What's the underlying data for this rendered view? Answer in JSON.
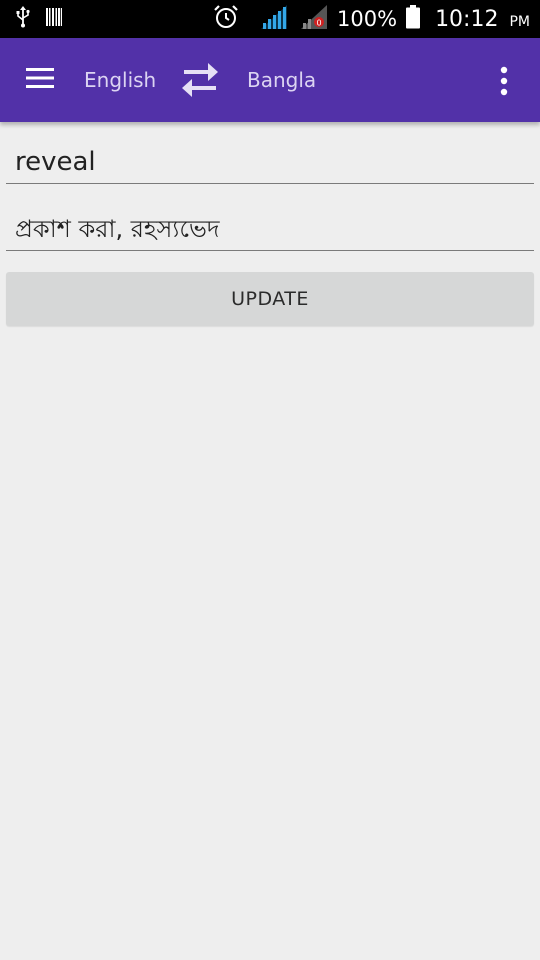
{
  "status_bar": {
    "battery_percent": "100%",
    "time": "10:12",
    "ampm": "PM",
    "icons": [
      "usb-icon",
      "barcode-icon",
      "alarm-icon",
      "signal-icon",
      "signal-no-sim-icon",
      "battery-icon"
    ]
  },
  "app_bar": {
    "menu_icon": "hamburger-menu-icon",
    "source_language": "English",
    "swap_icon": "swap-arrows-icon",
    "target_language": "Bangla",
    "overflow_icon": "more-vert-icon",
    "color": "#5231a8"
  },
  "main": {
    "source_text": "reveal",
    "translation_text": "প্রকাশ করা, রহস্যভেদ",
    "update_button_label": "UPDATE"
  }
}
